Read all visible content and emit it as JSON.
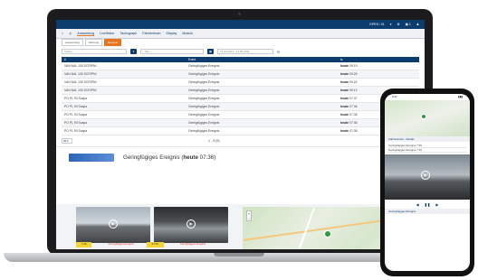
{
  "topbar": {
    "items": [
      "GPRS / 01",
      "▾",
      "⚙",
      "▣ 1",
      "♟"
    ]
  },
  "nav": {
    "home_icon": "home-icon",
    "items": [
      "Auswertung",
      "Livelhistor",
      "Tachograph",
      "Fahrtenbuch",
      "Display",
      "Module"
    ],
    "active": "Auswertung"
  },
  "subtabs": [
    "Auswertung",
    "Wertung",
    "Ereignis"
  ],
  "filters": {
    "search_placeholder": "Suche...",
    "select_value": "- Alle -",
    "date_range": "14.06.2021 - 14.06.2021"
  },
  "table": {
    "headers": [
      "#",
      "Event",
      "ts"
    ],
    "rows": [
      {
        "vehicle": "VAN NAL 130 SCRIPNI",
        "event": "Geringfügiges Ereignis",
        "day": "heute",
        "time": "09:19"
      },
      {
        "vehicle": "VAN NAL 130 SCRIPNI",
        "event": "Geringfügiges Ereignis",
        "day": "heute",
        "time": "09:25"
      },
      {
        "vehicle": "VAN NAL 130 SCRIPNI",
        "event": "Geringfügiges Ereignis",
        "day": "heute",
        "time": "09:24"
      },
      {
        "vehicle": "VAN NAL 130 SCRIPNI",
        "event": "Geringfügiges Ereignis",
        "day": "heute",
        "time": "09:13"
      },
      {
        "vehicle": "PO PL 90 Scapa",
        "event": "Geringfügiges Ereignis",
        "day": "heute",
        "time": "07:37"
      },
      {
        "vehicle": "PO PL 90 Scapa",
        "event": "Geringfügiges Ereignis",
        "day": "heute",
        "time": "07:36"
      },
      {
        "vehicle": "PO PL 90 Scapa",
        "event": "Geringfügiges Ereignis",
        "day": "heute",
        "time": "07:36"
      },
      {
        "vehicle": "PO PL 90 Scapa",
        "event": "Geringfügiges Ereignis",
        "day": "heute",
        "time": "07:36"
      },
      {
        "vehicle": "PO PL 90 Scapa",
        "event": "Geringfügiges Ereignis",
        "day": "heute",
        "time": "07:36"
      }
    ]
  },
  "pager": {
    "per_page": "25 ▾",
    "info": "1 - 9 (9)"
  },
  "detail": {
    "event_label": "Geringfügiges Ereignis",
    "day": "heute",
    "time": "07:36"
  },
  "media": {
    "cam1_time": "7:35",
    "cam1_tag": "Geringfügiges Ereignis",
    "cam2_time": "07:36",
    "cam2_tag": "Geringfügiges Ereignis"
  },
  "phone": {
    "status_time": "9:41",
    "status_icons": "▮▮▮",
    "section1": "Fahrtenbuch - Details",
    "list": [
      "Geringfügiges Ereignis 7:36",
      "Geringfügiges Ereignis 7:36"
    ],
    "section2": "Geringfügiges Ereignis"
  },
  "colors": {
    "brand": "#0c3c6e",
    "accent": "#e8741e",
    "map_pin": "#2d9a3e"
  }
}
